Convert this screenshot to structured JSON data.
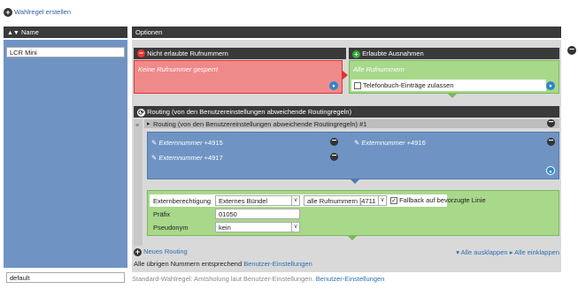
{
  "toolbar": {
    "add_rule": "Wahlregel erstellen"
  },
  "left": {
    "header": "Name",
    "rule_name": "LCR Mini",
    "default_name": "default"
  },
  "options": {
    "header": "Optionen",
    "not_allowed": {
      "header": "Nicht erlaubte Rufnummern",
      "text": "Keine Rufnummer gesperrt"
    },
    "exceptions": {
      "header": "Erlaubte Ausnahmen",
      "text": "Alle Rufnummern",
      "checkbox_label": "Telefonbuch-Einträge zulassen"
    },
    "routing": {
      "header": "Routing (von den Benutzereinstellungen abweichende Routingregeln)",
      "item_header": "Routing (von den Benutzereinstellungen abweichende Routingregeln) #1",
      "numbers": [
        {
          "label": "Externnummer",
          "value": "+4915"
        },
        {
          "label": "Externnummer",
          "value": "+4916"
        },
        {
          "label": "Externnummer",
          "value": "+4917"
        }
      ],
      "fields": {
        "ext_label": "Externberechtigung",
        "ext_value": "Externes Bündel",
        "numbers_value": "alle Rufnummern [4711",
        "fallback_label": "Fallback auf bevorzugte Linie",
        "prefix_label": "Präfix",
        "prefix_value": "01050",
        "pseudonym_label": "Pseudonym",
        "pseudonym_value": "kein"
      },
      "new_routing": "Neues Routing",
      "expand_all": "Alle ausklappen",
      "collapse_all": "Alle einklappen",
      "others_text": "Alle übrigen Nummern entsprechend",
      "others_link": "Benutzer-Einstellungen"
    },
    "footer_text": "Standard-Wahlregel: Amtsholung laut Benutzer-Einstellungen.",
    "footer_link": "Benutzer-Einstellungen"
  }
}
